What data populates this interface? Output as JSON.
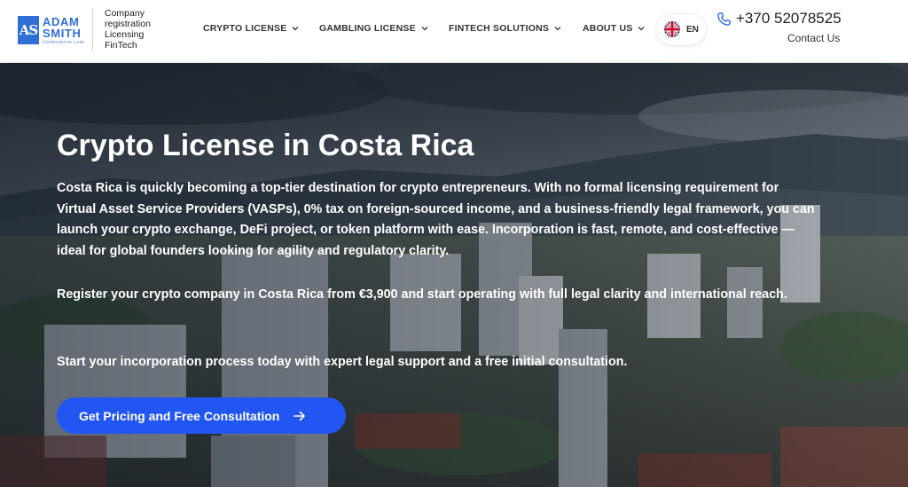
{
  "brand": {
    "logo_mark": "AS",
    "name_line1": "ADAM",
    "name_line2": "SMITH",
    "sub": "CORPORATE LAW",
    "tagline": [
      "Company",
      "registration",
      "Licensing",
      "FinTech"
    ],
    "accent_color": "#2f6fd6"
  },
  "nav": {
    "items": [
      {
        "label": "CRYPTO LICENSE",
        "icon": "chevron-down-icon"
      },
      {
        "label": "GAMBLING LICENSE",
        "icon": "chevron-down-icon"
      },
      {
        "label": "FINTECH SOLUTIONS",
        "icon": "chevron-down-icon"
      },
      {
        "label": "ABOUT US",
        "icon": "chevron-down-icon"
      }
    ],
    "language": {
      "label": "EN",
      "icon": "uk-flag-icon"
    }
  },
  "contact": {
    "phone": "+370 52078525",
    "phone_icon": "phone-icon",
    "link_label": "Contact Us"
  },
  "hero": {
    "title": "Crypto License in Costa Rica",
    "paragraphs": [
      "Costa Rica is quickly becoming a top-tier destination for crypto entrepreneurs. With no formal licensing requirement for Virtual Asset Service Providers (VASPs), 0% tax on foreign-sourced income, and a business-friendly legal framework, you can launch your crypto exchange, DeFi project, or token platform with ease. Incorporation is fast, remote, and cost-effective — ideal for global founders looking for agility and regulatory clarity.",
      "Register your crypto company in Costa Rica from €3,900 and start operating with full legal clarity and international reach.",
      "Start your incorporation process today with expert legal support and a free initial consultation."
    ],
    "cta_label": "Get Pricing and Free Consultation",
    "cta_icon": "arrow-right-icon",
    "cta_color": "#2156f2",
    "background": "city-skyline-photo"
  }
}
